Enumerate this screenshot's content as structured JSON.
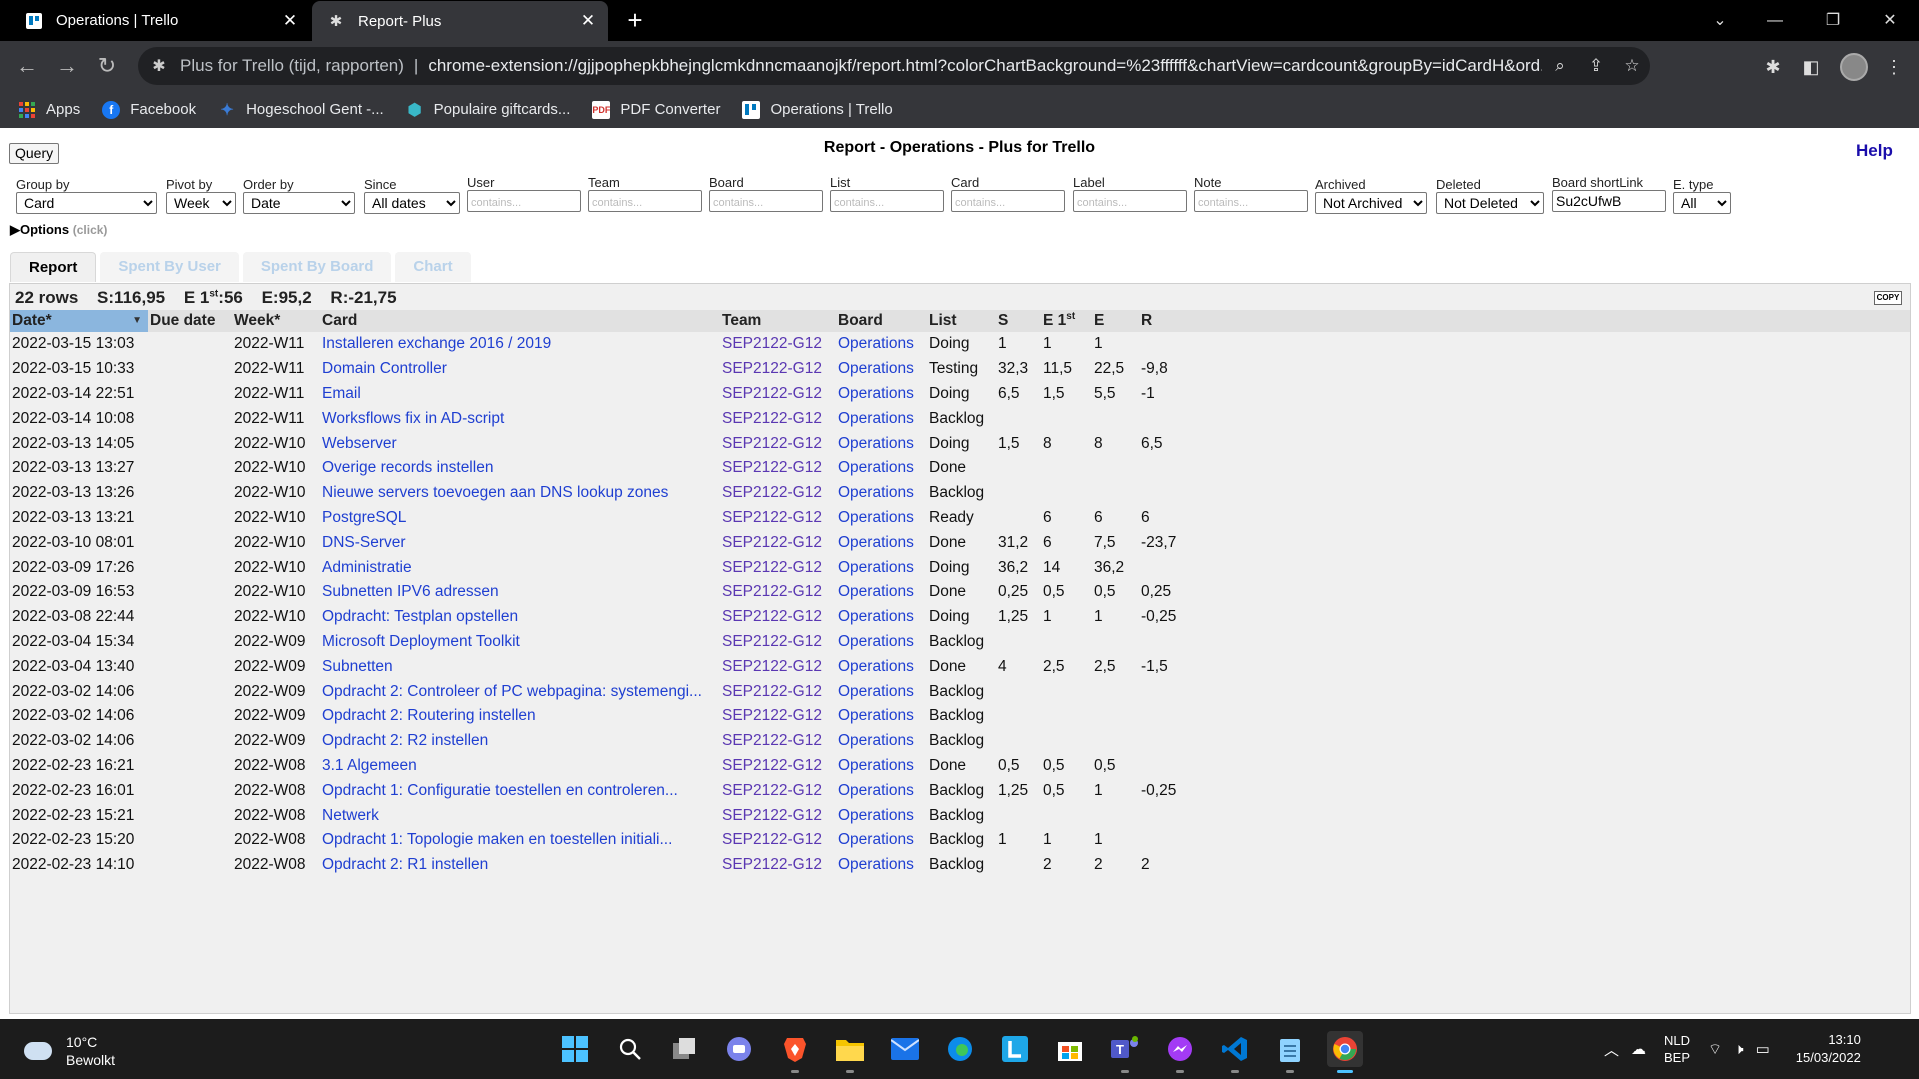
{
  "browser": {
    "tabs": [
      {
        "title": "Operations | Trello",
        "icon": "trello-icon",
        "active": false
      },
      {
        "title": "Report- Plus",
        "icon": "extension-icon",
        "active": true
      }
    ],
    "address": {
      "site_name": "Plus for Trello (tijd, rapporten)",
      "separator": "|",
      "url": "chrome-extension://gjjpophepkbhejnglcmkdnncmaanojkf/report.html?colorChartBackground=%23ffffff&chartView=cardcount&groupBy=idCardH&ord..."
    },
    "bookmarks": [
      {
        "label": "Apps",
        "icon": "apps-grid-icon"
      },
      {
        "label": "Facebook",
        "icon": "facebook-icon"
      },
      {
        "label": "Hogeschool Gent -...",
        "icon": "hogeschool-icon"
      },
      {
        "label": "Populaire giftcards...",
        "icon": "giftcard-icon"
      },
      {
        "label": "PDF Converter",
        "icon": "pdf-icon"
      },
      {
        "label": "Operations | Trello",
        "icon": "trello-icon"
      }
    ]
  },
  "report": {
    "query_label": "Query",
    "title": "Report - Operations - Plus for Trello",
    "help_label": "Help",
    "filters": {
      "group_by": {
        "label": "Group by",
        "value": "Card"
      },
      "pivot_by": {
        "label": "Pivot by",
        "value": "Week"
      },
      "order_by": {
        "label": "Order by",
        "value": "Date"
      },
      "since": {
        "label": "Since",
        "value": "All dates"
      },
      "user": {
        "label": "User",
        "placeholder": "contains..."
      },
      "team": {
        "label": "Team",
        "placeholder": "contains..."
      },
      "board": {
        "label": "Board",
        "placeholder": "contains..."
      },
      "list": {
        "label": "List",
        "placeholder": "contains..."
      },
      "card": {
        "label": "Card",
        "placeholder": "contains..."
      },
      "label": {
        "label": "Label",
        "placeholder": "contains..."
      },
      "note": {
        "label": "Note",
        "placeholder": "contains..."
      },
      "archived": {
        "label": "Archived",
        "value": "Not Archived"
      },
      "deleted": {
        "label": "Deleted",
        "value": "Not Deleted"
      },
      "board_shortlink": {
        "label": "Board shortLink",
        "value": "Su2cUfwB"
      },
      "e_type": {
        "label": "E. type",
        "value": "All"
      }
    },
    "options_label": "Options",
    "options_hint": "(click)",
    "tabs": [
      "Report",
      "Spent By User",
      "Spent By Board",
      "Chart"
    ],
    "summary": {
      "rows": "22 rows",
      "s": "S:116,95",
      "e1st_prefix": "E 1",
      "e1st_sup": "st",
      "e1st_value": ":56",
      "e": "E:95,2",
      "r": "R:-21,75"
    },
    "copy_label": "COPY",
    "columns": [
      "Date*",
      "Due date",
      "Week*",
      "Card",
      "Team",
      "Board",
      "List",
      "S",
      "E 1st",
      "E",
      "R"
    ],
    "rows": [
      [
        "2022-03-15 13:03",
        "",
        "2022-W11",
        "Installeren exchange 2016 / 2019",
        "SEP2122-G12",
        "Operations",
        "Doing",
        "1",
        "1",
        "1",
        ""
      ],
      [
        "2022-03-15 10:33",
        "",
        "2022-W11",
        "Domain Controller",
        "SEP2122-G12",
        "Operations",
        "Testing",
        "32,3",
        "11,5",
        "22,5",
        "-9,8"
      ],
      [
        "2022-03-14 22:51",
        "",
        "2022-W11",
        "Email",
        "SEP2122-G12",
        "Operations",
        "Doing",
        "6,5",
        "1,5",
        "5,5",
        "-1"
      ],
      [
        "2022-03-14 10:08",
        "",
        "2022-W11",
        "Worksflows fix in AD-script",
        "SEP2122-G12",
        "Operations",
        "Backlog",
        "",
        "",
        "",
        ""
      ],
      [
        "2022-03-13 14:05",
        "",
        "2022-W10",
        "Webserver",
        "SEP2122-G12",
        "Operations",
        "Doing",
        "1,5",
        "8",
        "8",
        "6,5"
      ],
      [
        "2022-03-13 13:27",
        "",
        "2022-W10",
        "Overige records instellen",
        "SEP2122-G12",
        "Operations",
        "Done",
        "",
        "",
        "",
        ""
      ],
      [
        "2022-03-13 13:26",
        "",
        "2022-W10",
        "Nieuwe servers toevoegen aan DNS lookup zones",
        "SEP2122-G12",
        "Operations",
        "Backlog",
        "",
        "",
        "",
        ""
      ],
      [
        "2022-03-13 13:21",
        "",
        "2022-W10",
        "PostgreSQL",
        "SEP2122-G12",
        "Operations",
        "Ready",
        "",
        "6",
        "6",
        "6"
      ],
      [
        "2022-03-10 08:01",
        "",
        "2022-W10",
        "DNS-Server",
        "SEP2122-G12",
        "Operations",
        "Done",
        "31,2",
        "6",
        "7,5",
        "-23,7"
      ],
      [
        "2022-03-09 17:26",
        "",
        "2022-W10",
        "Administratie",
        "SEP2122-G12",
        "Operations",
        "Doing",
        "36,2",
        "14",
        "36,2",
        ""
      ],
      [
        "2022-03-09 16:53",
        "",
        "2022-W10",
        "Subnetten IPV6 adressen",
        "SEP2122-G12",
        "Operations",
        "Done",
        "0,25",
        "0,5",
        "0,5",
        "0,25"
      ],
      [
        "2022-03-08 22:44",
        "",
        "2022-W10",
        "Opdracht: Testplan opstellen",
        "SEP2122-G12",
        "Operations",
        "Doing",
        "1,25",
        "1",
        "1",
        "-0,25"
      ],
      [
        "2022-03-04 15:34",
        "",
        "2022-W09",
        "Microsoft Deployment Toolkit",
        "SEP2122-G12",
        "Operations",
        "Backlog",
        "",
        "",
        "",
        ""
      ],
      [
        "2022-03-04 13:40",
        "",
        "2022-W09",
        "Subnetten",
        "SEP2122-G12",
        "Operations",
        "Done",
        "4",
        "2,5",
        "2,5",
        "-1,5"
      ],
      [
        "2022-03-02 14:06",
        "",
        "2022-W09",
        "Opdracht 2: Controleer of PC webpagina: systemengi...",
        "SEP2122-G12",
        "Operations",
        "Backlog",
        "",
        "",
        "",
        ""
      ],
      [
        "2022-03-02 14:06",
        "",
        "2022-W09",
        "Opdracht 2: Routering instellen",
        "SEP2122-G12",
        "Operations",
        "Backlog",
        "",
        "",
        "",
        ""
      ],
      [
        "2022-03-02 14:06",
        "",
        "2022-W09",
        "Opdracht 2: R2 instellen",
        "SEP2122-G12",
        "Operations",
        "Backlog",
        "",
        "",
        "",
        ""
      ],
      [
        "2022-02-23 16:21",
        "",
        "2022-W08",
        "3.1 Algemeen",
        "SEP2122-G12",
        "Operations",
        "Done",
        "0,5",
        "0,5",
        "0,5",
        ""
      ],
      [
        "2022-02-23 16:01",
        "",
        "2022-W08",
        "Opdracht 1: Configuratie toestellen en controleren...",
        "SEP2122-G12",
        "Operations",
        "Backlog",
        "1,25",
        "0,5",
        "1",
        "-0,25"
      ],
      [
        "2022-02-23 15:21",
        "",
        "2022-W08",
        "Netwerk",
        "SEP2122-G12",
        "Operations",
        "Backlog",
        "",
        "",
        "",
        ""
      ],
      [
        "2022-02-23 15:20",
        "",
        "2022-W08",
        "Opdracht 1: Topologie maken en toestellen initiali...",
        "SEP2122-G12",
        "Operations",
        "Backlog",
        "1",
        "1",
        "1",
        ""
      ],
      [
        "2022-02-23 14:10",
        "",
        "2022-W08",
        "Opdracht 2: R1 instellen",
        "SEP2122-G12",
        "Operations",
        "Backlog",
        "",
        "2",
        "2",
        "2"
      ]
    ]
  },
  "taskbar": {
    "weather": {
      "temp": "10°C",
      "desc": "Bewolkt"
    },
    "apps": [
      "start-icon",
      "search-icon",
      "task-view-icon",
      "chat-icon",
      "brave-icon",
      "file-explorer-icon",
      "mail-icon",
      "edge-icon",
      "l-app-icon",
      "store-icon",
      "teams-icon",
      "messenger-icon",
      "vscode-icon",
      "notepad-icon",
      "chrome-icon"
    ],
    "lang_top": "NLD",
    "lang_bottom": "BEP",
    "time": "13:10",
    "date": "15/03/2022"
  },
  "colors": {
    "link": "#1f3fd1",
    "team_link": "#5a37b2",
    "sorted_header": "#8bb6de",
    "taskbar": "#1c1c1c",
    "browser_chrome": "#35363a"
  }
}
